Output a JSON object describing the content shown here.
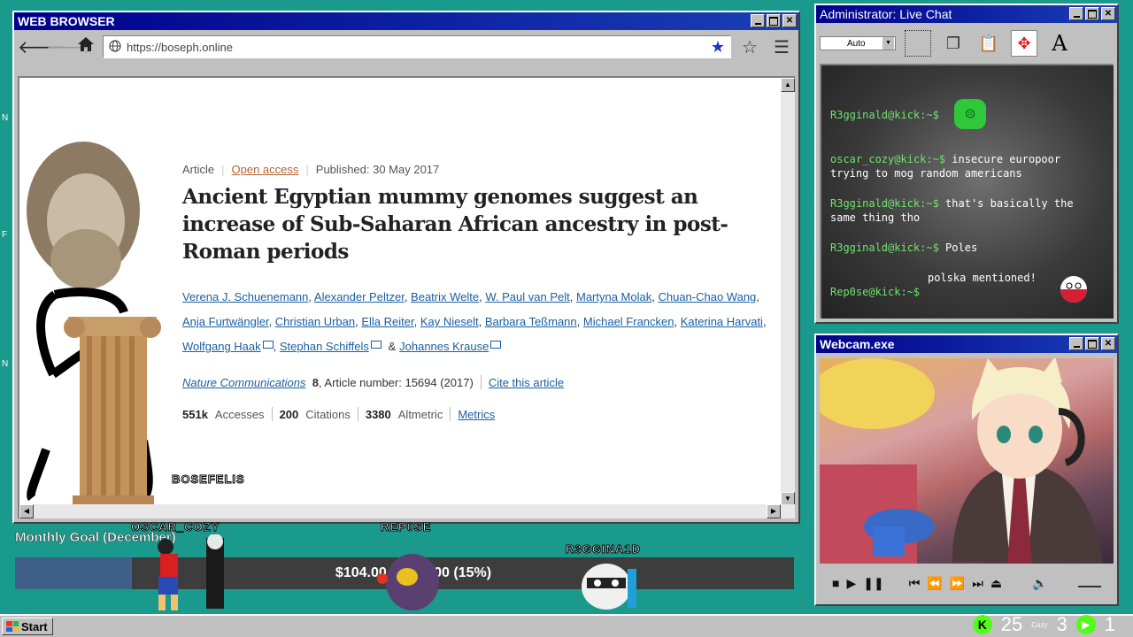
{
  "colors": {
    "desktop": "#1a9a8c",
    "titlebar": "#00008a",
    "link": "#1a5fa3",
    "chat_user": "#6fe36f",
    "kick_green": "#53fc18",
    "goal_fill": "#3e5f88"
  },
  "browser": {
    "title": "WEB BROWSER",
    "url": "https://boseph.online",
    "article": {
      "type": "Article",
      "access": "Open access",
      "published": "Published: 30 May 2017",
      "title": "Ancient Egyptian mummy genomes suggest an increase of Sub-Saharan African ancestry in post-Roman periods",
      "authors": [
        "Verena J. Schuenemann",
        "Alexander Peltzer",
        "Beatrix Welte",
        "W. Paul van Pelt",
        "Martyna Molak",
        "Chuan-Chao Wang",
        "Anja Furtwängler",
        "Christian Urban",
        "Ella Reiter",
        "Kay Nieselt",
        "Barbara Teßmann",
        "Michael Francken",
        "Katerina Harvati",
        "Wolfgang Haak",
        "Stephan Schiffels",
        "Johannes Krause"
      ],
      "author_and": "&",
      "journal": "Nature Communications",
      "volume": "8",
      "article_number": ", Article number: 15694 (2017)",
      "cite": "Cite this article",
      "metrics": {
        "accesses_value": "551k",
        "accesses_label": "Accesses",
        "citations_value": "200",
        "citations_label": "Citations",
        "altmetric_value": "3380",
        "altmetric_label": "Altmetric",
        "metrics_link": "Metrics"
      }
    },
    "overlay_label": "BOSEFELIS"
  },
  "chat": {
    "title": "Administrator: Live Chat",
    "zoom_select": "Auto",
    "messages": [
      {
        "user": "R3gginald@kick:~$",
        "text": ""
      },
      {
        "user": "oscar_cozy@kick:~$",
        "text": " insecure europoor trying to mog random americans"
      },
      {
        "user": "R3gginald@kick:~$",
        "text": " that's basically the same thing tho"
      },
      {
        "user": "R3gginald@kick:~$",
        "text": " Poles"
      },
      {
        "user": "",
        "text": "polska mentioned!"
      },
      {
        "user": "Rep0se@kick:~$",
        "text": ""
      }
    ]
  },
  "webcam": {
    "title": "Webcam.exe"
  },
  "goal": {
    "title": "Monthly Goal (December)",
    "text": "$104.00 / $700.00 (15%)",
    "progress": 0.15,
    "names": [
      "OSCAR_COZY",
      "REP0SE",
      "R3GGINA1D"
    ]
  },
  "taskbar": {
    "start": "Start",
    "tray_count_1": "25",
    "tray_cozy": "Cozy",
    "tray_count_2": "3",
    "tray_count_3": "1"
  }
}
